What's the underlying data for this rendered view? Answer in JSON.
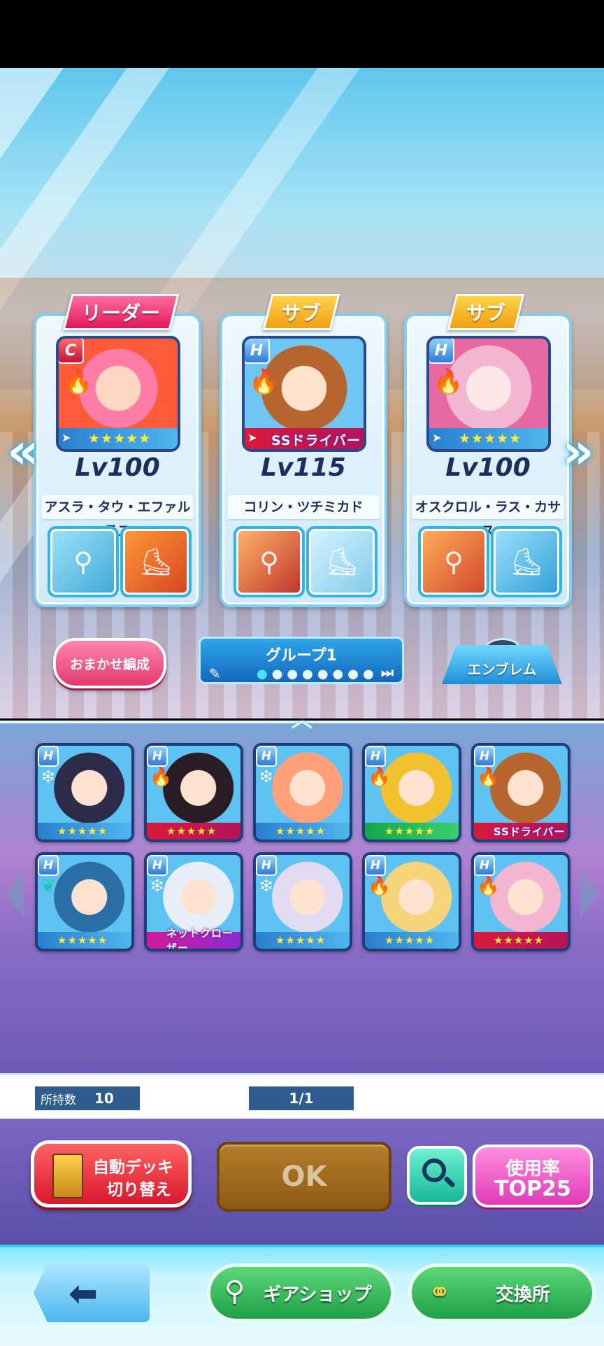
{
  "party": {
    "cards": [
      {
        "tag": "リーダー",
        "level": "Lv100",
        "name": "アスラ・タウ・エファルテス",
        "rarity": "C",
        "stars": "★★★★★",
        "trait": ""
      },
      {
        "tag": "サブ",
        "level": "Lv115",
        "name": "コリン・ツチミカド",
        "rarity": "H",
        "stars": "",
        "trait": "SSドライバー"
      },
      {
        "tag": "サブ",
        "level": "Lv100",
        "name": "オスクロル・ラス・カサス",
        "rarity": "H",
        "stars": "★★★★★",
        "trait": ""
      }
    ]
  },
  "controls": {
    "auto_assign": "おまかせ編成",
    "group_name": "グループ1",
    "group_dots": "●●●●●●●●",
    "emblem": "エンブレム",
    "collapse": "︿"
  },
  "roster": {
    "items": [
      {
        "rarity": "H",
        "stars": "★★★★★",
        "trait": ""
      },
      {
        "rarity": "H",
        "stars": "★★★★★",
        "trait": ""
      },
      {
        "rarity": "H",
        "stars": "★★★★★",
        "trait": ""
      },
      {
        "rarity": "H",
        "stars": "★★★★★",
        "trait": ""
      },
      {
        "rarity": "H",
        "stars": "",
        "trait": "SSドライバー"
      },
      {
        "rarity": "H",
        "stars": "★★★★★",
        "trait": ""
      },
      {
        "rarity": "H",
        "stars": "",
        "trait": "ネットクローザー"
      },
      {
        "rarity": "H",
        "stars": "★★★★★",
        "trait": ""
      },
      {
        "rarity": "H",
        "stars": "★★★★★",
        "trait": ""
      },
      {
        "rarity": "H",
        "stars": "★★★★★",
        "trait": ""
      }
    ]
  },
  "info": {
    "owned_label": "所持数",
    "owned_count": "10",
    "page": "1/1"
  },
  "actions": {
    "auto_deck_line1": "自動デッキ",
    "auto_deck_line2": "切り替え",
    "ok": "OK",
    "usage_line1": "使用率",
    "usage_line2": "TOP25"
  },
  "nav": {
    "back_icon": "arrow-left",
    "gear_shop": "ギアショップ",
    "exchange": "交換所"
  },
  "icons": {
    "search": "magnifier",
    "edit": "pencil",
    "skip_end": "skip-forward"
  }
}
